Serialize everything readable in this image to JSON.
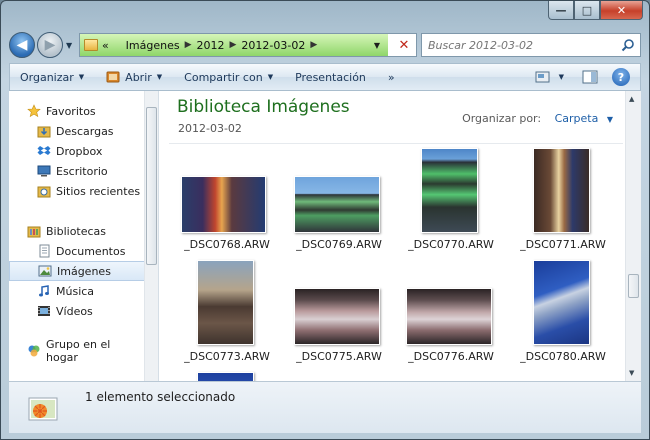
{
  "address": {
    "back_symbol": "◀",
    "forward_symbol": "▶",
    "chevrons": "«",
    "crumbs": [
      "Imágenes",
      "2012",
      "2012-03-02"
    ],
    "crumb_sep": "▶",
    "dropdown": "▼",
    "close": "✕"
  },
  "search": {
    "placeholder": "Buscar 2012-03-02",
    "icon": "search-icon"
  },
  "toolbar": {
    "organize": "Organizar",
    "open": "Abrir",
    "share": "Compartir con",
    "presentation": "Presentación",
    "more": "»",
    "help": "?"
  },
  "nav": {
    "favorites": "Favoritos",
    "downloads": "Descargas",
    "dropbox": "Dropbox",
    "desktop": "Escritorio",
    "recent": "Sitios recientes",
    "libraries": "Bibliotecas",
    "documents": "Documentos",
    "images": "Imágenes",
    "music": "Música",
    "videos": "Vídeos",
    "homegroup": "Grupo en el hogar"
  },
  "content": {
    "title": "Biblioteca Imágenes",
    "subtitle": "2012-03-02",
    "arrange_label": "Organizar por:",
    "arrange_value": "Carpeta",
    "files": [
      {
        "name": "_DSC0768.ARW"
      },
      {
        "name": "_DSC0769.ARW"
      },
      {
        "name": "_DSC0770.ARW"
      },
      {
        "name": "_DSC0771.ARW"
      },
      {
        "name": "_DSC0773.ARW"
      },
      {
        "name": "_DSC0775.ARW"
      },
      {
        "name": "_DSC0776.ARW"
      },
      {
        "name": "_DSC0780.ARW"
      }
    ]
  },
  "status": {
    "text": "1 elemento seleccionado"
  },
  "colors": {
    "library_title": "#1e6f1e",
    "link_blue": "#1e5fa8",
    "address_green": "#8fd66a",
    "close_red": "#c6402a"
  }
}
